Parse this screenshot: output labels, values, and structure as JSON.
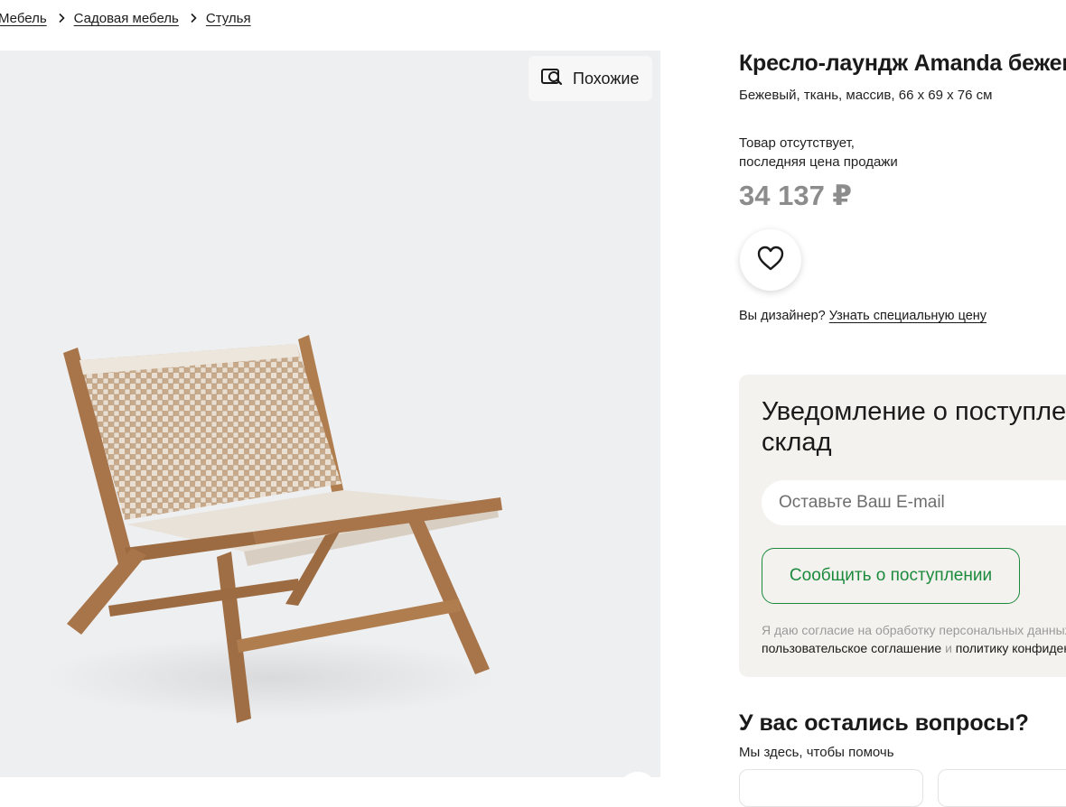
{
  "breadcrumb": [
    "Мебель",
    "Садовая мебель",
    "Стулья"
  ],
  "gallery": {
    "similar_label": "Похожие",
    "similar_icon": "image-search-icon",
    "product_image": "lounge-chair-photo"
  },
  "product": {
    "title": "Кресло-лаундж Amanda бежевый",
    "subtitle": "Бежевый, ткань, массив, 66 x 69 x 76 см",
    "stock_line1": "Товар отсутствует,",
    "stock_line2": "последняя цена продажи",
    "price": "34 137 ₽",
    "favorite_icon": "heart-icon"
  },
  "designer": {
    "prompt": "Вы дизайнер?",
    "link": "Узнать специальную цену"
  },
  "notify": {
    "title_line1": "Уведомление о поступлении на",
    "title_line2": "склад",
    "email_placeholder": "Оставьте Ваш E-mail",
    "button": "Сообщить о поступлении",
    "consent_line1": "Я даю согласие на обработку персональных данных",
    "consent_link1": "пользовательское соглашение",
    "consent_and": "и",
    "consent_link2": "политику конфиденциальности"
  },
  "questions": {
    "title": "У вас остались вопросы?",
    "subtitle": "Мы здесь, чтобы помочь"
  },
  "colors": {
    "accent_green": "#1c8a3c",
    "price_gray": "#8c8c8c",
    "gallery_bg": "#eeeff1",
    "card_bg": "#f3f2ee"
  }
}
